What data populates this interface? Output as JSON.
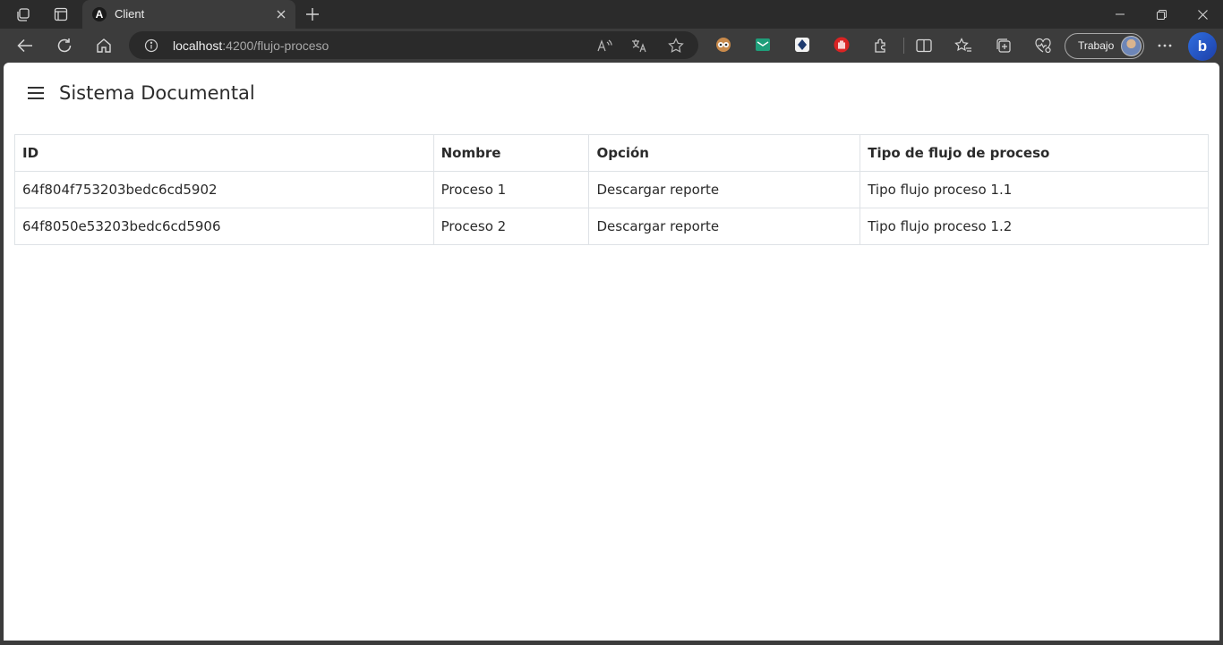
{
  "browser": {
    "tab": {
      "title": "Client",
      "favicon_letter": "A"
    },
    "address": {
      "host": "localhost",
      "rest": ":4200/flujo-proceso"
    },
    "profile": {
      "label": "Trabajo"
    },
    "bing_letter": "b"
  },
  "app": {
    "title": "Sistema Documental"
  },
  "table": {
    "headers": [
      "ID",
      "Nombre",
      "Opción",
      "Tipo de flujo de proceso"
    ],
    "rows": [
      [
        "64f804f753203bedc6cd5902",
        "Proceso 1",
        "Descargar reporte",
        "Tipo flujo proceso 1.1"
      ],
      [
        "64f8050e53203bedc6cd5906",
        "Proceso 2",
        "Descargar reporte",
        "Tipo flujo proceso 1.2"
      ]
    ]
  },
  "icons": {
    "titlebar": [
      "workspaces-icon",
      "tab-actions-icon",
      "close-icon",
      "plus-icon",
      "minimize-icon",
      "restore-icon",
      "window-close-icon"
    ],
    "toolbar": [
      "back-icon",
      "refresh-icon",
      "home-icon",
      "info-icon",
      "read-aloud-icon",
      "translate-icon",
      "favorite-star-icon",
      "extensions-icon",
      "split-screen-icon",
      "favorites-icon",
      "collections-icon",
      "performance-icon",
      "more-icon"
    ]
  }
}
